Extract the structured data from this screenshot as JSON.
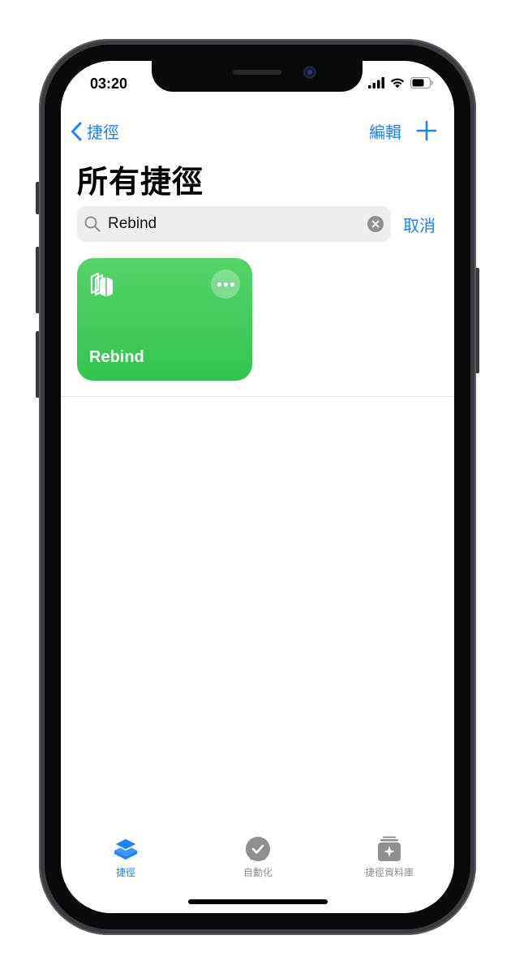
{
  "status": {
    "time": "03:20"
  },
  "nav": {
    "back_label": "捷徑",
    "edit_label": "編輯"
  },
  "page": {
    "title": "所有捷徑"
  },
  "search": {
    "value": "Rebind",
    "cancel_label": "取消"
  },
  "shortcuts": [
    {
      "label": "Rebind",
      "color": "#3fca59"
    }
  ],
  "tabbar": {
    "items": [
      {
        "label": "捷徑",
        "icon": "layers-icon",
        "active": true
      },
      {
        "label": "自動化",
        "icon": "clock-check-icon",
        "active": false
      },
      {
        "label": "捷徑資料庫",
        "icon": "gallery-icon",
        "active": false
      }
    ]
  },
  "colors": {
    "accent": "#1a82fb",
    "tile_green": "#3fca59",
    "inactive": "#8e8e93"
  }
}
